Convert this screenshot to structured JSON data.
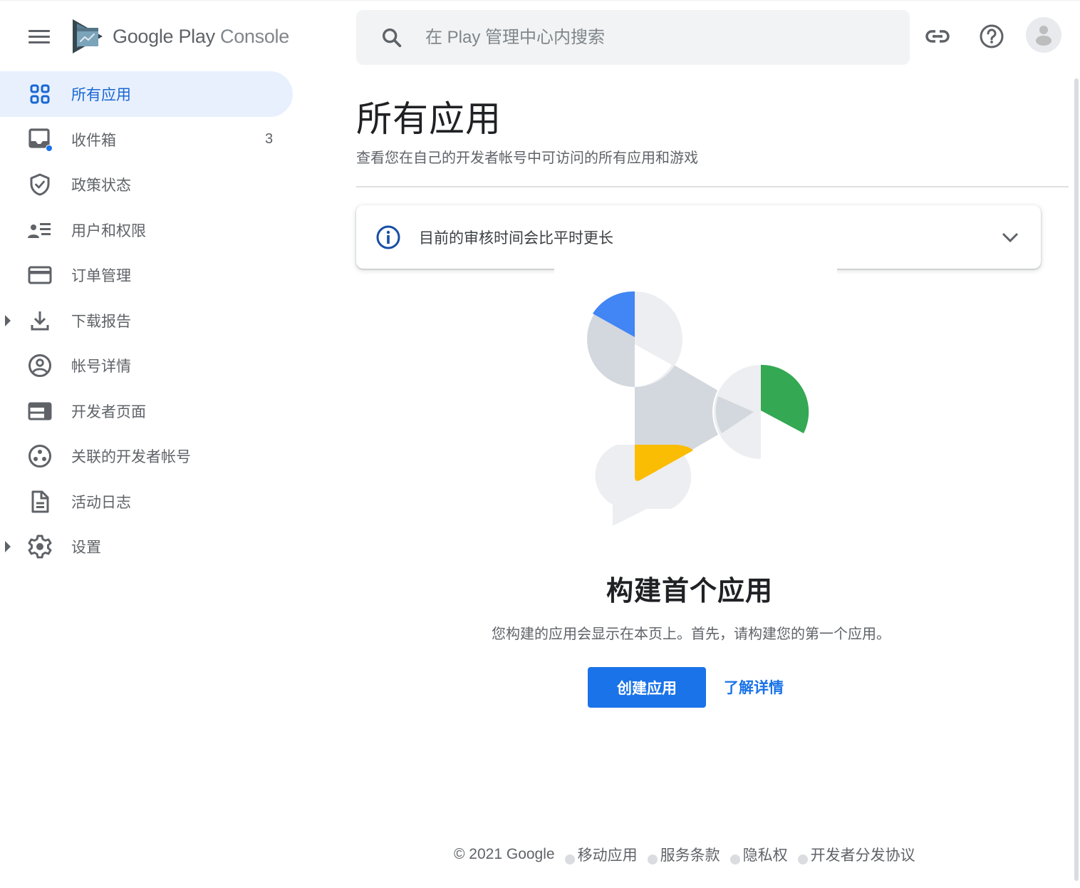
{
  "app": {
    "name_main": "Google Play",
    "name_sub": " Console"
  },
  "search": {
    "placeholder": "在 Play 管理中心内搜索",
    "value": ""
  },
  "header_icons": [
    "link-icon",
    "help-icon",
    "account-avatar"
  ],
  "sidebar": {
    "items": [
      {
        "label": "所有应用",
        "icon": "apps-grid-icon",
        "active": true
      },
      {
        "label": "收件箱",
        "icon": "inbox-icon",
        "count": "3",
        "badge_color": "#1a73e8"
      },
      {
        "label": "政策状态",
        "icon": "shield-check-icon"
      },
      {
        "label": "用户和权限",
        "icon": "users-permissions-icon"
      },
      {
        "label": "订单管理",
        "icon": "credit-card-icon"
      },
      {
        "label": "下载报告",
        "icon": "download-icon",
        "expandable": true
      },
      {
        "label": "帐号详情",
        "icon": "account-circle-icon"
      },
      {
        "label": "开发者页面",
        "icon": "developer-page-icon"
      },
      {
        "label": "关联的开发者帐号",
        "icon": "linked-accounts-icon"
      },
      {
        "label": "活动日志",
        "icon": "document-icon"
      },
      {
        "label": "设置",
        "icon": "gear-icon",
        "expandable": true
      }
    ]
  },
  "main": {
    "title": "所有应用",
    "subtitle": "查看您在自己的开发者帐号中可访问的所有应用和游戏",
    "notice": {
      "text": "目前的审核时间会比平时更长",
      "icon": "info-icon"
    },
    "empty_state": {
      "title": "构建首个应用",
      "description": "您构建的应用会显示在本页上。首先，请构建您的第一个应用。",
      "primary_button": "创建应用",
      "secondary_link": "了解详情"
    }
  },
  "footer": {
    "copyright": "© 2021 Google",
    "links": [
      "移动应用",
      "服务条款",
      "隐私权",
      "开发者分发协议"
    ]
  },
  "colors": {
    "accent": "#1a73e8",
    "active_bg": "#e8f0fe",
    "active_text": "#1967d2",
    "illus_blue": "#4285f4",
    "illus_green": "#34a853",
    "illus_yellow": "#fbbc04"
  }
}
